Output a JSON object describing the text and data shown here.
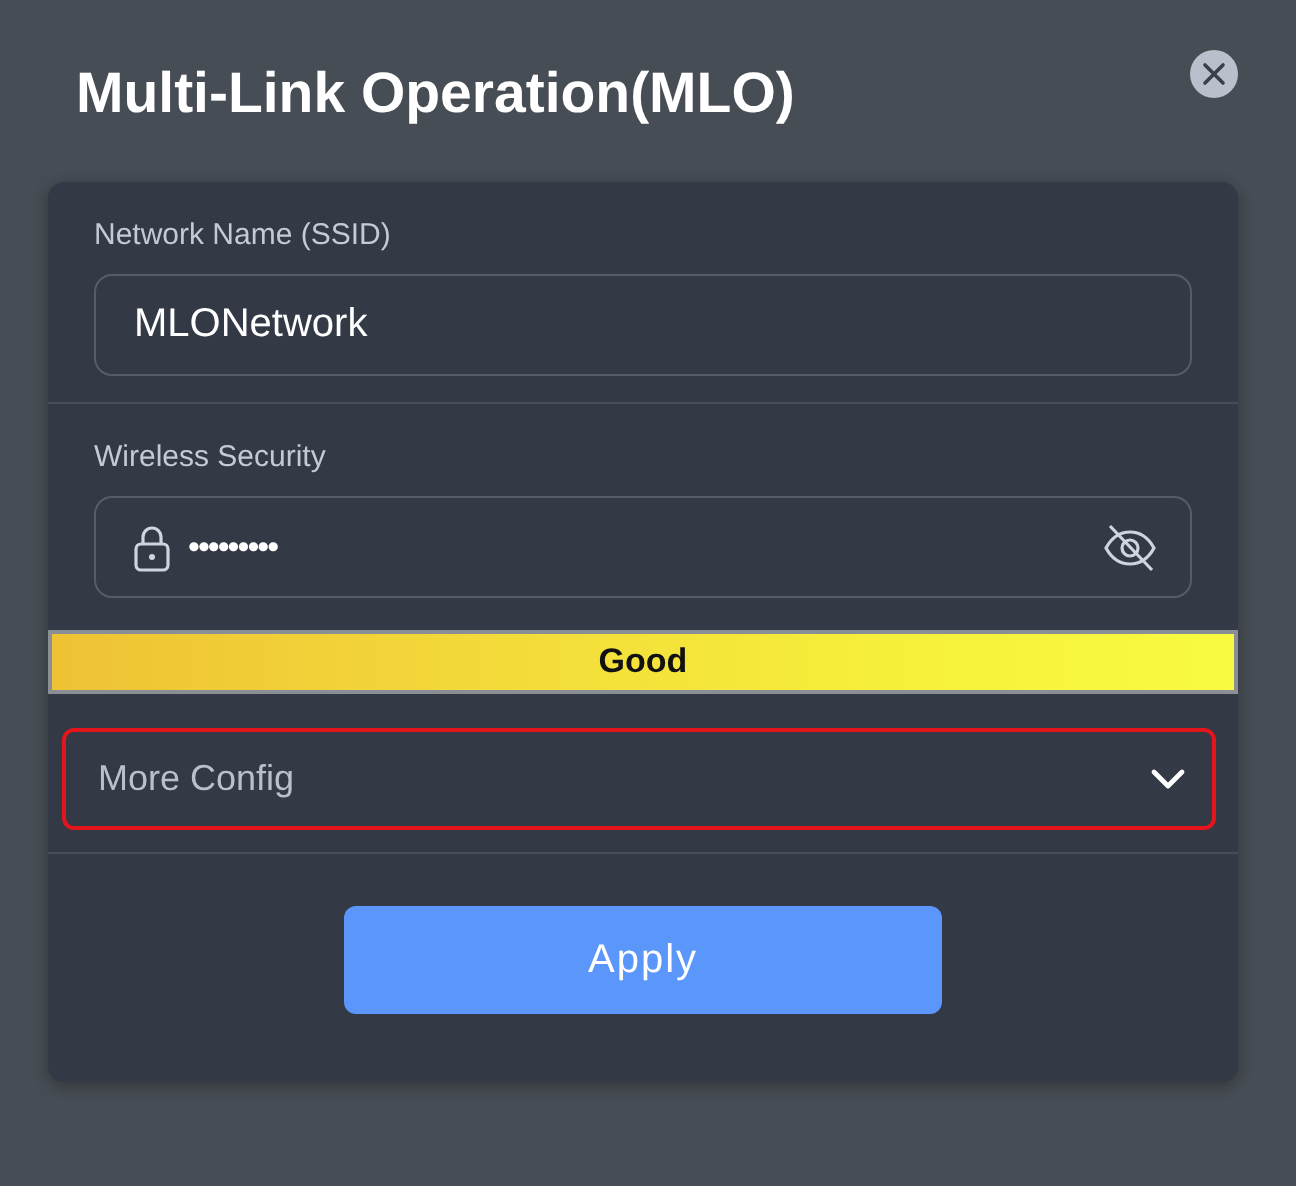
{
  "dialog": {
    "title": "Multi-Link Operation(MLO)"
  },
  "fields": [
    {
      "kind": "text",
      "label": "Network Name (SSID)",
      "value": "MLONetwork"
    },
    {
      "kind": "password",
      "label": "Wireless Security",
      "value": "•••••••••"
    }
  ],
  "strength": {
    "label": "Good"
  },
  "more_config": {
    "label": "More Config",
    "expanded": false,
    "highlighted": true
  },
  "buttons": [
    "Apply"
  ]
}
